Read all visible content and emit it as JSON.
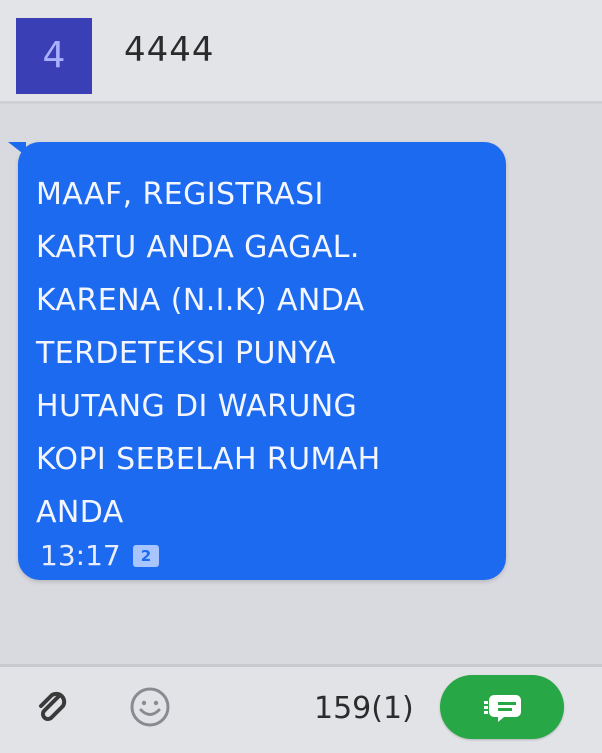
{
  "header": {
    "avatar_letter": "4",
    "contact_name": "4444"
  },
  "message": {
    "text": "MAAF, REGISTRASI\nKARTU ANDA GAGAL.\nKARENA (N.I.K) ANDA\nTERDETEKSI PUNYA\nHUTANG DI WARUNG\nKOPI SEBELAH RUMAH\nANDA",
    "time": "13:17",
    "sim_badge": "2"
  },
  "composer": {
    "char_count": "159(1)",
    "attach_icon": "paperclip-icon",
    "emoji_icon": "smiley-icon",
    "send_icon": "send-message-icon"
  },
  "colors": {
    "bubble": "#1c6af0",
    "avatar": "#3a3fb6",
    "send_button": "#27a745",
    "background": "#d9dadf"
  }
}
